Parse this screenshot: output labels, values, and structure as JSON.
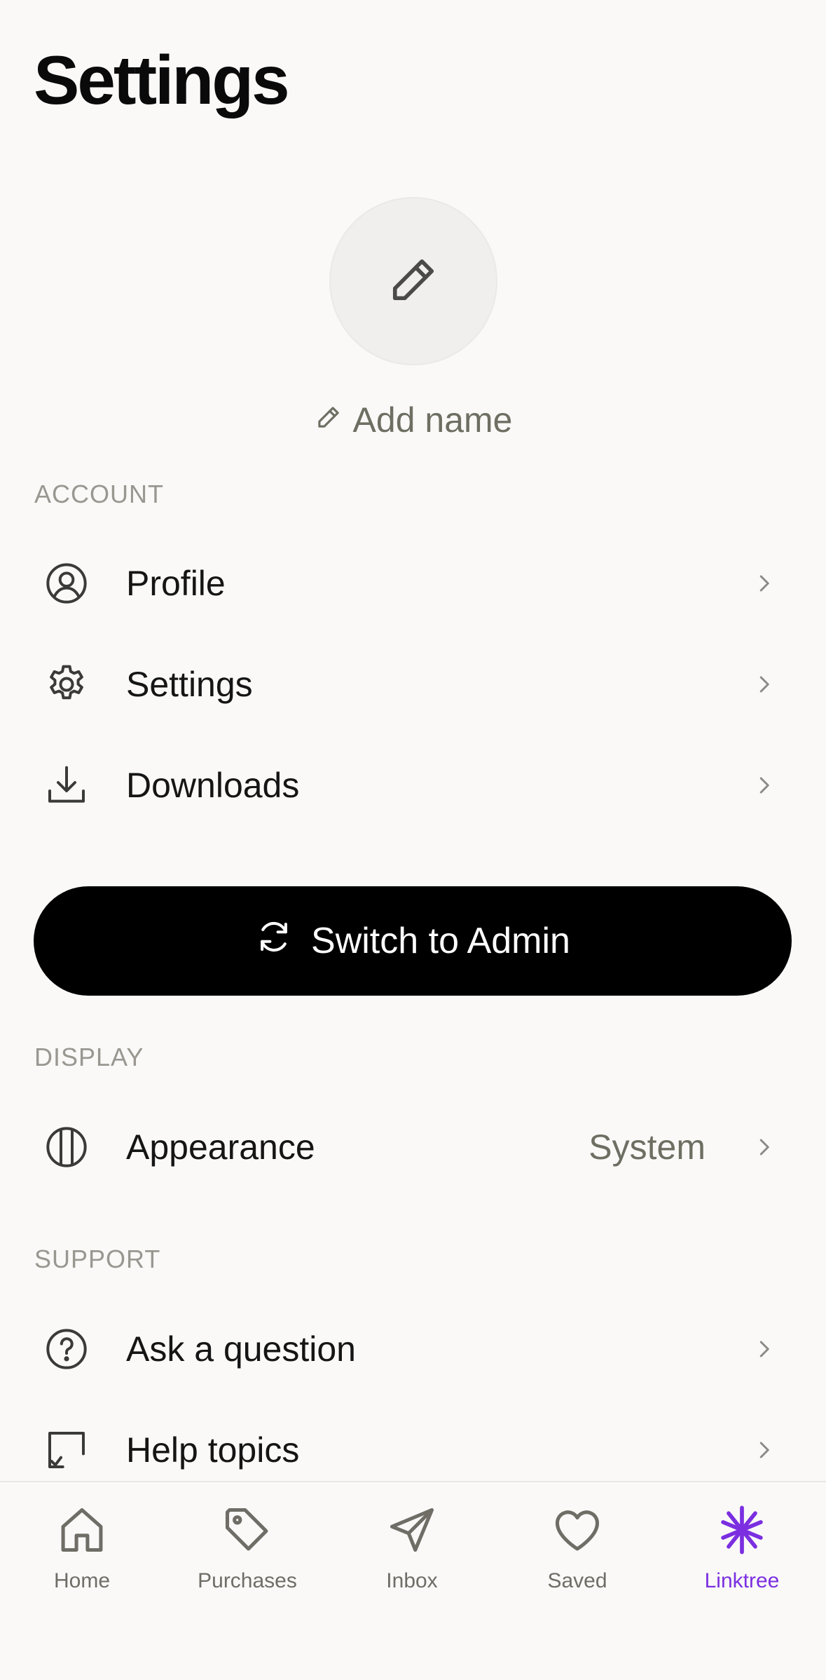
{
  "header": {
    "title": "Settings"
  },
  "profile": {
    "add_name_label": "Add name"
  },
  "sections": {
    "account": "ACCOUNT",
    "display": "DISPLAY",
    "support": "SUPPORT"
  },
  "account_items": [
    {
      "label": "Profile",
      "icon": "user-circle-icon"
    },
    {
      "label": "Settings",
      "icon": "gear-icon"
    },
    {
      "label": "Downloads",
      "icon": "download-icon"
    }
  ],
  "switch_button": {
    "label": "Switch to Admin",
    "icon": "refresh-icon"
  },
  "display_items": [
    {
      "label": "Appearance",
      "value": "System",
      "icon": "appearance-icon"
    }
  ],
  "support_items": [
    {
      "label": "Ask a question",
      "icon": "question-circle-icon"
    },
    {
      "label": "Help topics",
      "icon": "help-topics-icon"
    }
  ],
  "tabbar": {
    "items": [
      {
        "label": "Home",
        "icon": "home-icon",
        "active": false
      },
      {
        "label": "Purchases",
        "icon": "tag-icon",
        "active": false
      },
      {
        "label": "Inbox",
        "icon": "send-icon",
        "active": false
      },
      {
        "label": "Saved",
        "icon": "heart-icon",
        "active": false
      },
      {
        "label": "Linktree",
        "icon": "linktree-icon",
        "active": true
      }
    ]
  },
  "colors": {
    "background": "#faf9f8",
    "accent": "#7b2fe0",
    "muted_text": "#6d6f62",
    "section_label": "#9a9791",
    "button_bg": "#000000"
  }
}
